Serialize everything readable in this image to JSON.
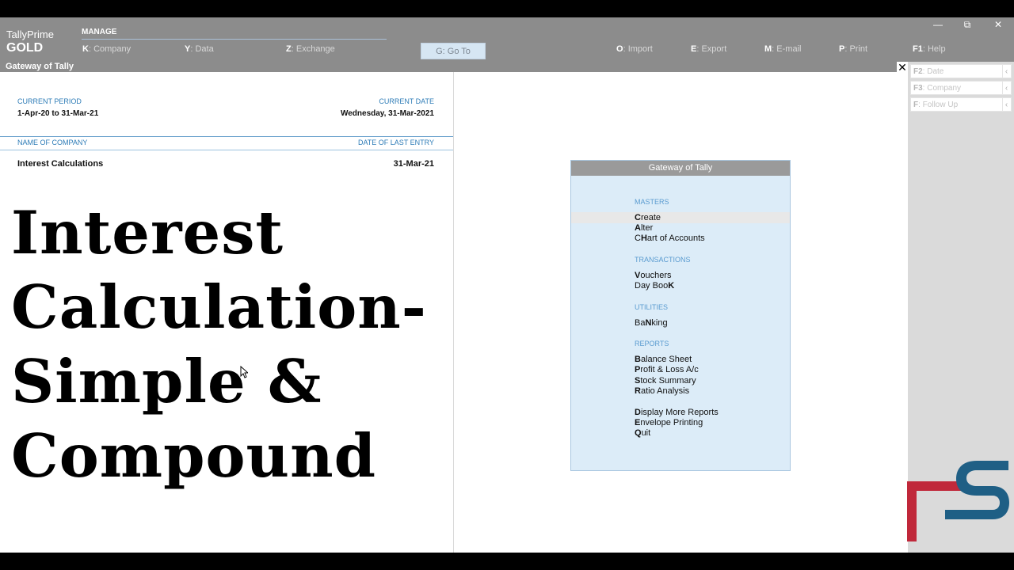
{
  "app": {
    "name": "TallyPrime",
    "edition": "GOLD"
  },
  "topbar": {
    "section": "MANAGE",
    "menu": [
      {
        "key": "K",
        "label": "Company"
      },
      {
        "key": "Y",
        "label": "Data"
      },
      {
        "key": "Z",
        "label": "Exchange"
      },
      {
        "key": "G",
        "label": "Go To"
      },
      {
        "key": "O",
        "label": "Import"
      },
      {
        "key": "E",
        "label": "Export"
      },
      {
        "key": "M",
        "label": "E-mail"
      },
      {
        "key": "P",
        "label": "Print"
      },
      {
        "key": "F1",
        "label": "Help"
      }
    ]
  },
  "window": {
    "title": "Gateway of Tally"
  },
  "company_info": {
    "current_period_label": "CURRENT PERIOD",
    "current_period": "1-Apr-20 to 31-Mar-21",
    "current_date_label": "CURRENT DATE",
    "current_date": "Wednesday, 31-Mar-2021",
    "name_label": "NAME OF COMPANY",
    "last_entry_label": "DATE OF LAST ENTRY",
    "company_name": "Interest Calculations",
    "last_entry": "31-Mar-21"
  },
  "overlay_title": [
    "Interest",
    "Calculation-",
    "Simple &",
    "Compound"
  ],
  "gateway_menu": {
    "title": "Gateway of Tally",
    "sections": {
      "masters": "MASTERS",
      "transactions": "TRANSACTIONS",
      "utilities": "UTILITIES",
      "reports": "REPORTS"
    },
    "items": {
      "create_key": "C",
      "create_rest": "reate",
      "alter_key": "A",
      "alter_rest": "lter",
      "chart_pre": "C",
      "chart_key": "H",
      "chart_rest": "art of Accounts",
      "vouchers_key": "V",
      "vouchers_rest": "ouchers",
      "daybook_pre": "Day Boo",
      "daybook_key": "K",
      "banking_pre": "Ba",
      "banking_key": "N",
      "banking_rest": "king",
      "bs_key": "B",
      "bs_rest": "alance Sheet",
      "pl_key": "P",
      "pl_rest": "rofit & Loss A/c",
      "ss_key": "S",
      "ss_rest": "tock Summary",
      "ra_key": "R",
      "ra_rest": "atio Analysis",
      "dmr_key": "D",
      "dmr_rest": "isplay More Reports",
      "ep_key": "E",
      "ep_rest": "nvelope Printing",
      "quit_key": "Q",
      "quit_rest": "uit"
    }
  },
  "right_buttons": [
    {
      "key": "F2",
      "label": "Date"
    },
    {
      "key": "F3",
      "label": "Company"
    },
    {
      "key": "F",
      "label": "Follow Up"
    }
  ],
  "colors": {
    "accent_blue": "#2e7cb7",
    "gateway_bg": "#dcecf8",
    "bar_gray": "#8c8c8c",
    "logo_red": "#c0283a",
    "logo_blue": "#1f5f85"
  }
}
